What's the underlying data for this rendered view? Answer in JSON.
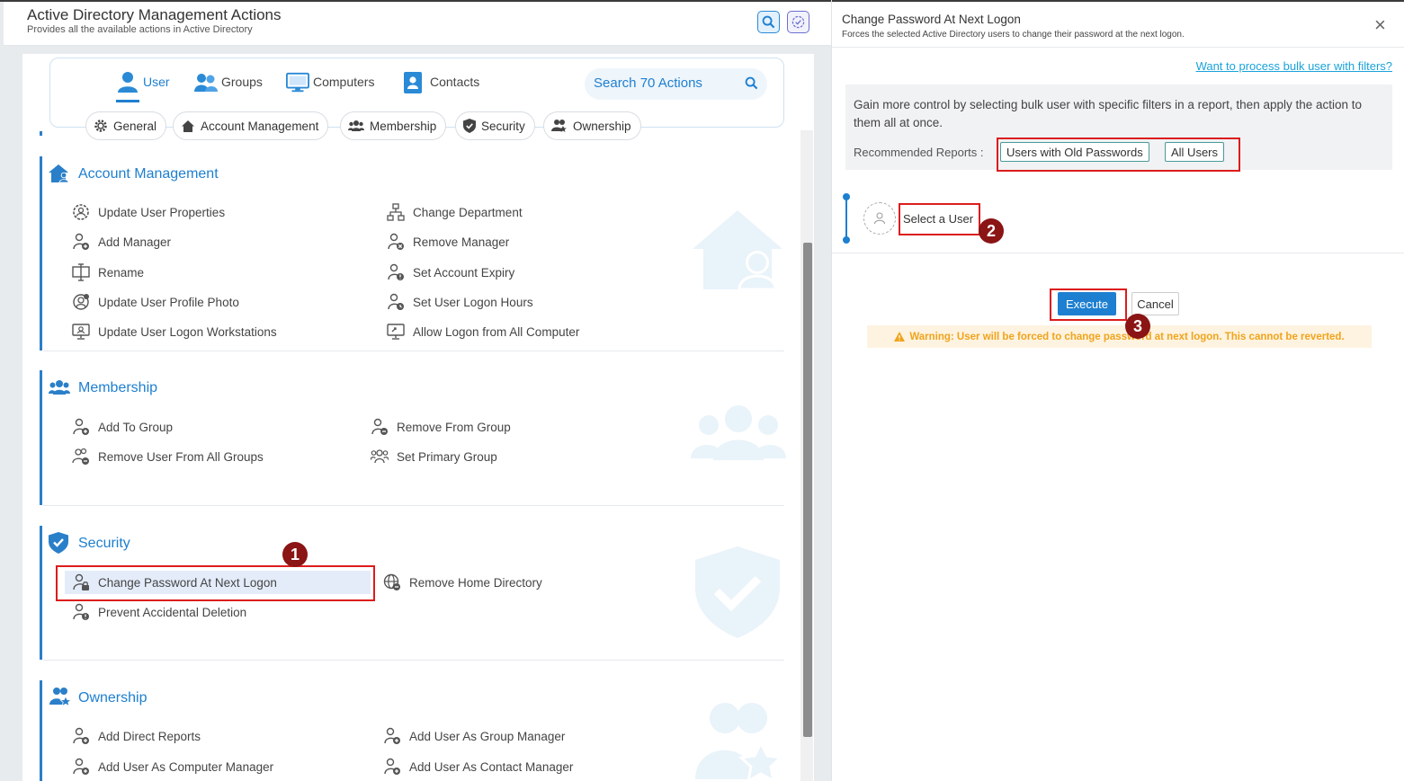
{
  "header": {
    "title": "Active Directory Management Actions",
    "subtitle": "Provides all the available actions in Active Directory"
  },
  "tabs": [
    {
      "label": "User",
      "active": true
    },
    {
      "label": "Groups"
    },
    {
      "label": "Computers"
    },
    {
      "label": "Contacts"
    }
  ],
  "search": {
    "placeholder": "Search 70 Actions"
  },
  "chips": [
    "General",
    "Account Management",
    "Membership",
    "Security",
    "Ownership"
  ],
  "sections": {
    "account_management": {
      "title": "Account Management",
      "col1": [
        "Update User Properties",
        "Add Manager",
        "Rename",
        "Update User Profile Photo",
        "Update User Logon Workstations"
      ],
      "col2": [
        "Change Department",
        "Remove Manager",
        "Set Account Expiry",
        "Set User Logon Hours",
        "Allow Logon from All Computer"
      ]
    },
    "membership": {
      "title": "Membership",
      "col1": [
        "Add To Group",
        "Remove User From All Groups"
      ],
      "col2": [
        "Remove From Group",
        "Set Primary Group"
      ]
    },
    "security": {
      "title": "Security",
      "col1": [
        "Change Password At Next Logon",
        "Prevent Accidental Deletion"
      ],
      "col2": [
        "Remove Home Directory"
      ]
    },
    "ownership": {
      "title": "Ownership",
      "col1": [
        "Add Direct Reports",
        "Add User As Computer Manager"
      ],
      "col2": [
        "Add User As Group Manager",
        "Add User As Contact Manager"
      ]
    }
  },
  "badges": [
    "1",
    "2",
    "3"
  ],
  "panel": {
    "title": "Change Password At Next Logon",
    "subtitle": "Forces the selected Active Directory users to change their password at the next logon.",
    "close": "×",
    "bulk_link": "Want to process bulk user with filters?",
    "info": "Gain more control by selecting bulk user with specific filters in a report, then apply the action to them all at once.",
    "recommended_label": "Recommended Reports :",
    "reports": [
      "Users with Old Passwords",
      "All Users"
    ],
    "select_user": "Select a User",
    "execute": "Execute",
    "cancel": "Cancel",
    "warning": "Warning: User will be forced to change password at next logon. This cannot be reverted."
  },
  "colors": {
    "accent": "#1e7fd0",
    "highlight_border": "#dc1c1c",
    "badge": "#8b1414",
    "warning_text": "#f0a41c",
    "warning_bg": "#fdf3e0"
  }
}
